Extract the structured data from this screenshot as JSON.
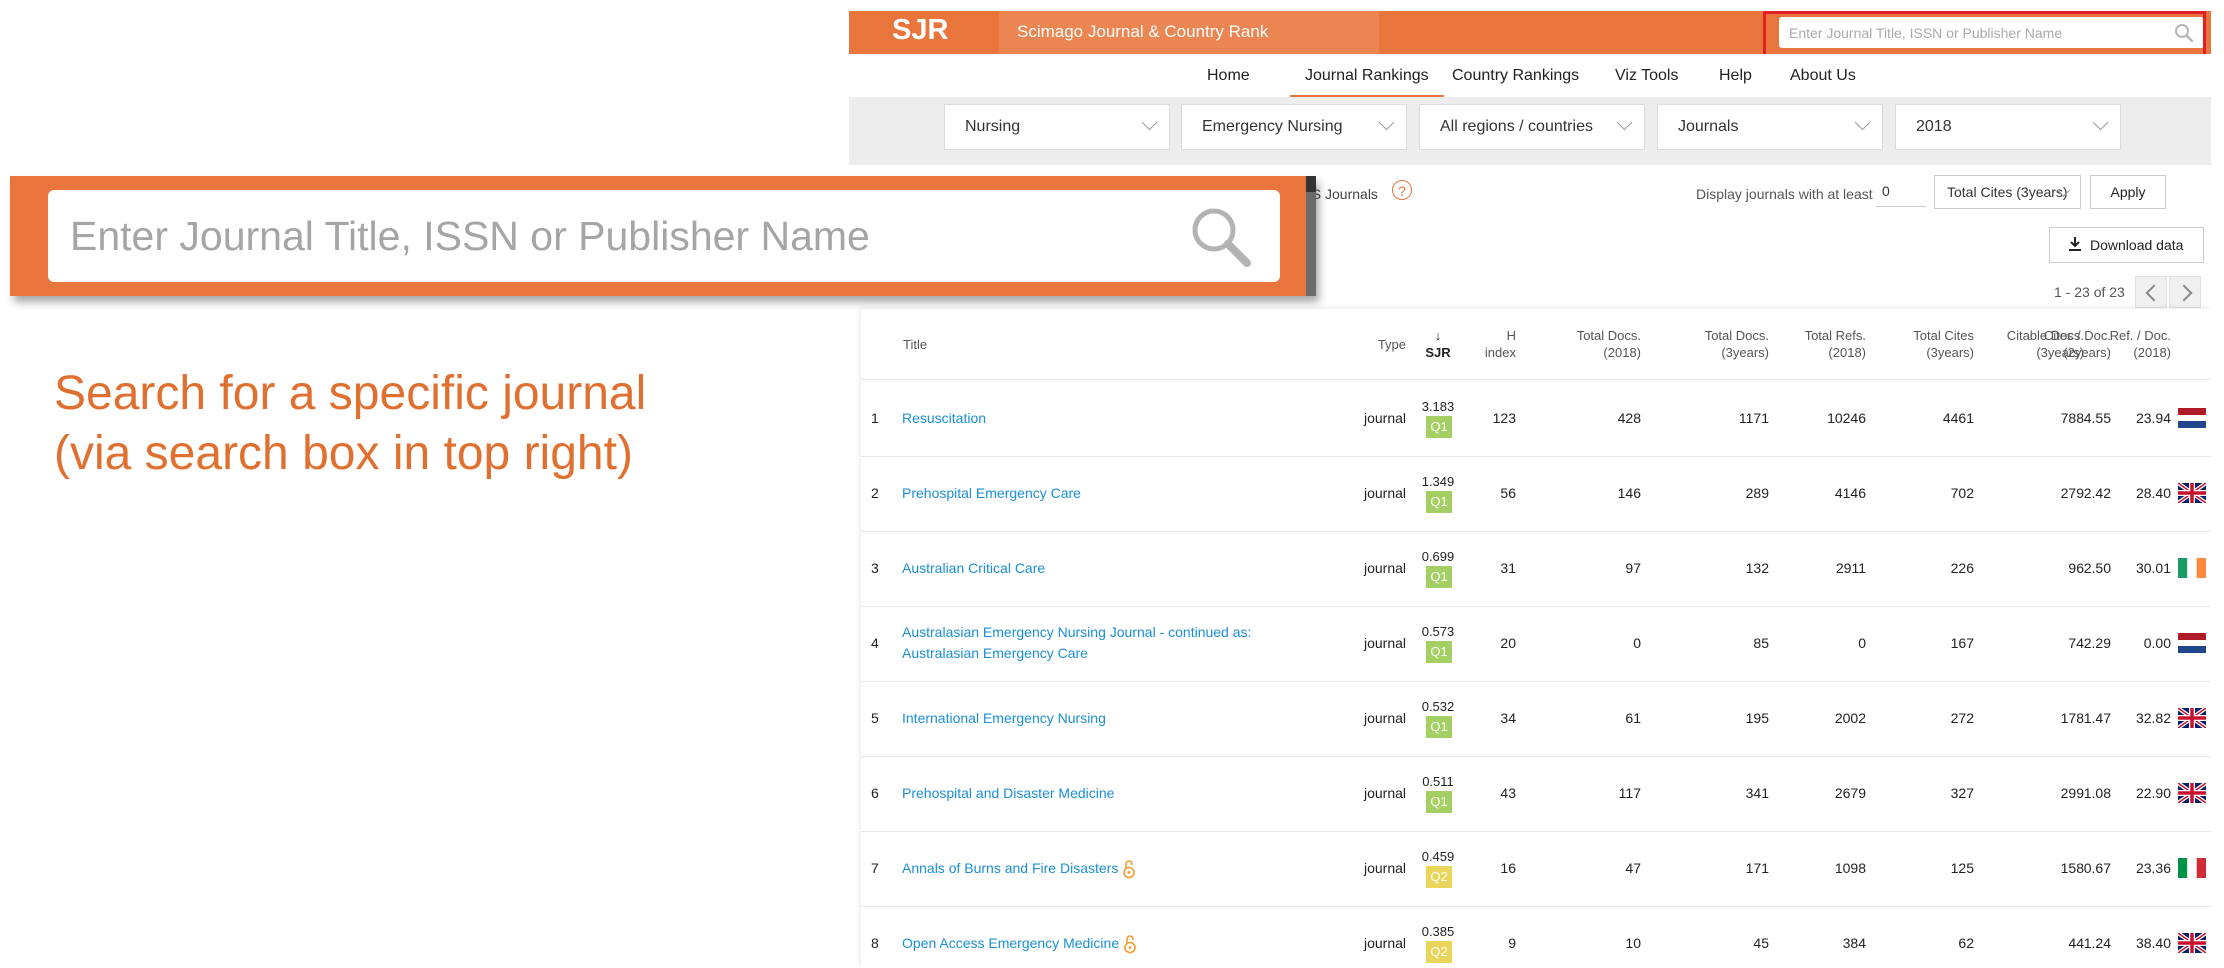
{
  "header": {
    "logo": "SJR",
    "brand": "Scimago Journal & Country Rank",
    "search_placeholder": "Enter Journal Title, ISSN or Publisher Name"
  },
  "nav": {
    "items": [
      {
        "label": "Home"
      },
      {
        "label": "Journal Rankings"
      },
      {
        "label": "Country Rankings"
      },
      {
        "label": "Viz Tools"
      },
      {
        "label": "Help"
      },
      {
        "label": "About Us"
      }
    ],
    "active": "Journal Rankings"
  },
  "filters": {
    "subject_area": "Nursing",
    "category": "Emergency Nursing",
    "region": "All regions / countries",
    "type": "Journals",
    "year": "2018"
  },
  "options": {
    "oa_label_partial": "oS Journals",
    "help_glyph": "?",
    "display_label": "Display journals with at least",
    "min_value": "0",
    "metric": "Total Cites (3years)",
    "apply_label": "Apply",
    "download_label": "Download data",
    "pager_text": "1 - 23 of 23"
  },
  "table": {
    "headers": {
      "title": "Title",
      "type": "Type",
      "sjr_arrow": "↓",
      "sjr": "SJR",
      "h_line1": "H",
      "h_line2": "index",
      "docs_line1": "Total Docs.",
      "docs_line2": "(2018)",
      "docs3_line1": "Total Docs.",
      "docs3_line2": "(3years)",
      "refs_line1": "Total Refs.",
      "refs_line2": "(2018)",
      "cites_line1": "Total Cites",
      "cites_line2": "(3years)",
      "citable_line1": "Citable Docs.",
      "citable_line2": "(3years)",
      "cpd_line1": "Cites / Doc.",
      "cpd_line2": "(2years)",
      "rpd_line1": "Ref. / Doc.",
      "rpd_line2": "(2018)"
    },
    "rows": [
      {
        "rank": "1",
        "title": "Resuscitation",
        "title2": "",
        "oa": false,
        "type": "journal",
        "sjr": "3.183",
        "quartile": "Q1",
        "h": "123",
        "docs": "428",
        "docs3": "1171",
        "refs": "10246",
        "cites": "4461",
        "citable": "788",
        "cpd": "4.55",
        "rpd": "23.94",
        "flag": "netherlands-flag"
      },
      {
        "rank": "2",
        "title": "Prehospital Emergency Care",
        "title2": "",
        "oa": false,
        "type": "journal",
        "sjr": "1.349",
        "quartile": "Q1",
        "h": "56",
        "docs": "146",
        "docs3": "289",
        "refs": "4146",
        "cites": "702",
        "citable": "279",
        "cpd": "2.42",
        "rpd": "28.40",
        "flag": "uk-flag"
      },
      {
        "rank": "3",
        "title": "Australian Critical Care",
        "title2": "",
        "oa": false,
        "type": "journal",
        "sjr": "0.699",
        "quartile": "Q1",
        "h": "31",
        "docs": "97",
        "docs3": "132",
        "refs": "2911",
        "cites": "226",
        "citable": "96",
        "cpd": "2.50",
        "rpd": "30.01",
        "flag": "ireland-flag"
      },
      {
        "rank": "4",
        "title": "Australasian Emergency Nursing Journal - continued as:",
        "title2": "Australasian Emergency Care",
        "oa": false,
        "type": "journal",
        "sjr": "0.573",
        "quartile": "Q1",
        "h": "20",
        "docs": "0",
        "docs3": "85",
        "refs": "0",
        "cites": "167",
        "citable": "74",
        "cpd": "2.29",
        "rpd": "0.00",
        "flag": "netherlands-flag"
      },
      {
        "rank": "5",
        "title": "International Emergency Nursing",
        "title2": "",
        "oa": false,
        "type": "journal",
        "sjr": "0.532",
        "quartile": "Q1",
        "h": "34",
        "docs": "61",
        "docs3": "195",
        "refs": "2002",
        "cites": "272",
        "citable": "178",
        "cpd": "1.47",
        "rpd": "32.82",
        "flag": "uk-flag"
      },
      {
        "rank": "6",
        "title": "Prehospital and Disaster Medicine",
        "title2": "",
        "oa": false,
        "type": "journal",
        "sjr": "0.511",
        "quartile": "Q1",
        "h": "43",
        "docs": "117",
        "docs3": "341",
        "refs": "2679",
        "cites": "327",
        "citable": "299",
        "cpd": "1.08",
        "rpd": "22.90",
        "flag": "uk-flag"
      },
      {
        "rank": "7",
        "title": "Annals of Burns and Fire Disasters",
        "title2": "",
        "oa": true,
        "type": "journal",
        "sjr": "0.459",
        "quartile": "Q2",
        "h": "16",
        "docs": "47",
        "docs3": "171",
        "refs": "1098",
        "cites": "125",
        "citable": "158",
        "cpd": "0.67",
        "rpd": "23.36",
        "flag": "italy-flag"
      },
      {
        "rank": "8",
        "title": "Open Access Emergency Medicine",
        "title2": "",
        "oa": true,
        "type": "journal",
        "sjr": "0.385",
        "quartile": "Q2",
        "h": "9",
        "docs": "10",
        "docs3": "45",
        "refs": "384",
        "cites": "62",
        "citable": "44",
        "cpd": "1.24",
        "rpd": "38.40",
        "flag": "uk-flag"
      }
    ]
  },
  "colors": {
    "brand_orange": "#e8753c",
    "q1_green": "#a4cf63",
    "q2_yellow": "#e8d559",
    "link_blue": "#1a8fd6",
    "highlight_red": "#e41e26"
  },
  "callout": {
    "zoom_placeholder": "Enter Journal Title, ISSN or Publisher Name",
    "caption_line1": "Search for a specific journal",
    "caption_line2": "(via search box in top right)"
  }
}
